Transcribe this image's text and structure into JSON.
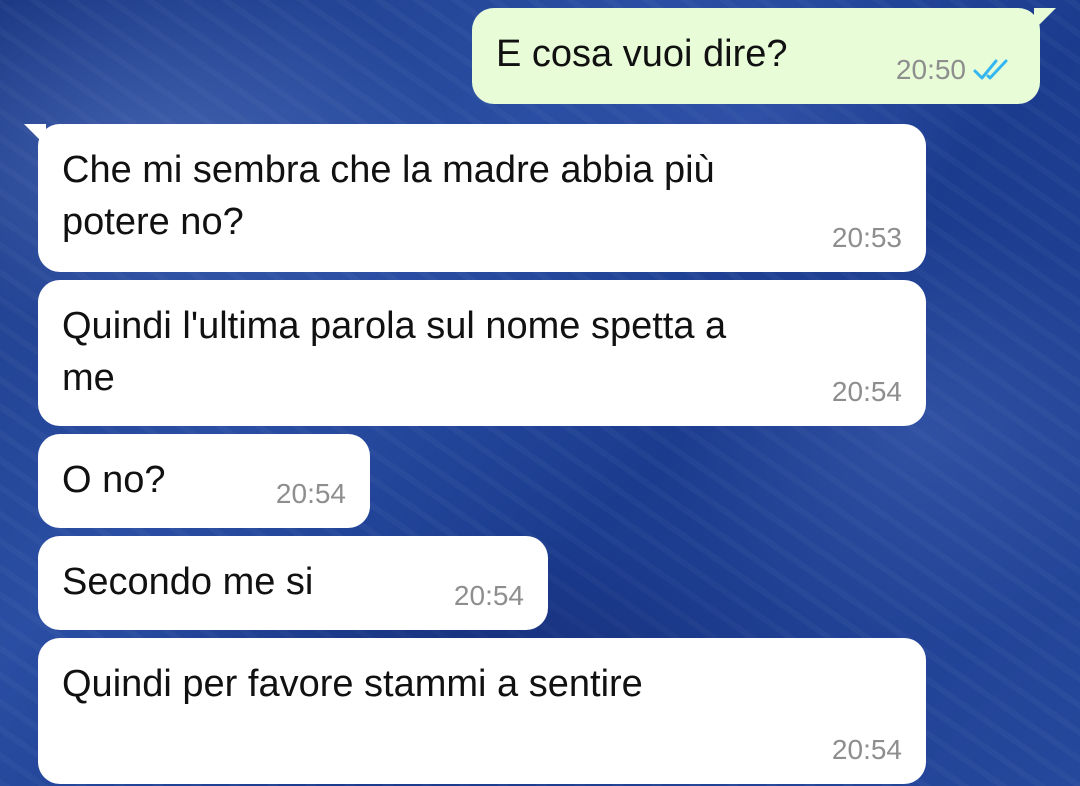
{
  "chat": {
    "messages": [
      {
        "text": "E cosa vuoi dire?",
        "time": "20:50",
        "status_icon": "double-check-icon",
        "direction": "outgoing"
      },
      {
        "text": "Che mi sembra che la madre abbia più\npotere no?",
        "time": "20:53",
        "direction": "incoming"
      },
      {
        "text": "Quindi l'ultima parola sul nome spetta a\nme",
        "time": "20:54",
        "direction": "incoming"
      },
      {
        "text": "O no?",
        "time": "20:54",
        "direction": "incoming"
      },
      {
        "text": "Secondo me si",
        "time": "20:54",
        "direction": "incoming"
      },
      {
        "text": "Quindi per favore stammi a sentire",
        "time": "20:54",
        "direction": "incoming"
      }
    ]
  },
  "colors": {
    "outgoing_bubble": "#e7fcd7",
    "incoming_bubble": "#ffffff",
    "read_check": "#34b7f1",
    "background": "#1d3a86"
  }
}
